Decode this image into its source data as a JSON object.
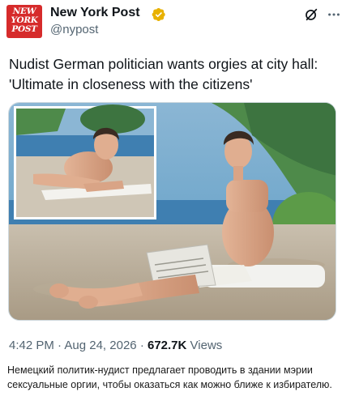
{
  "account": {
    "avatar_lines": [
      "NEW",
      "YORK",
      "POST"
    ],
    "display_name": "New York Post",
    "handle": "@nypost",
    "verified_color": "#e8b100"
  },
  "tweet": {
    "text": "Nudist German politician wants orgies at city hall: 'Ultimate in closeness with the citizens'"
  },
  "meta": {
    "time": "4:42 PM",
    "separator": "·",
    "date": "Aug 24, 2026",
    "views_count": "672.7K",
    "views_label": "Views"
  },
  "caption": {
    "text": "Немецкий политик-нудист предлагает проводить в здании мэрии сексуальные оргии, чтобы оказаться как можно ближе к избирателю."
  },
  "colors": {
    "brand_red": "#d62b2b",
    "text_primary": "#0f1419",
    "text_secondary": "#536471"
  },
  "icons": {
    "header_actions": [
      "grok-icon",
      "more-icon"
    ]
  }
}
